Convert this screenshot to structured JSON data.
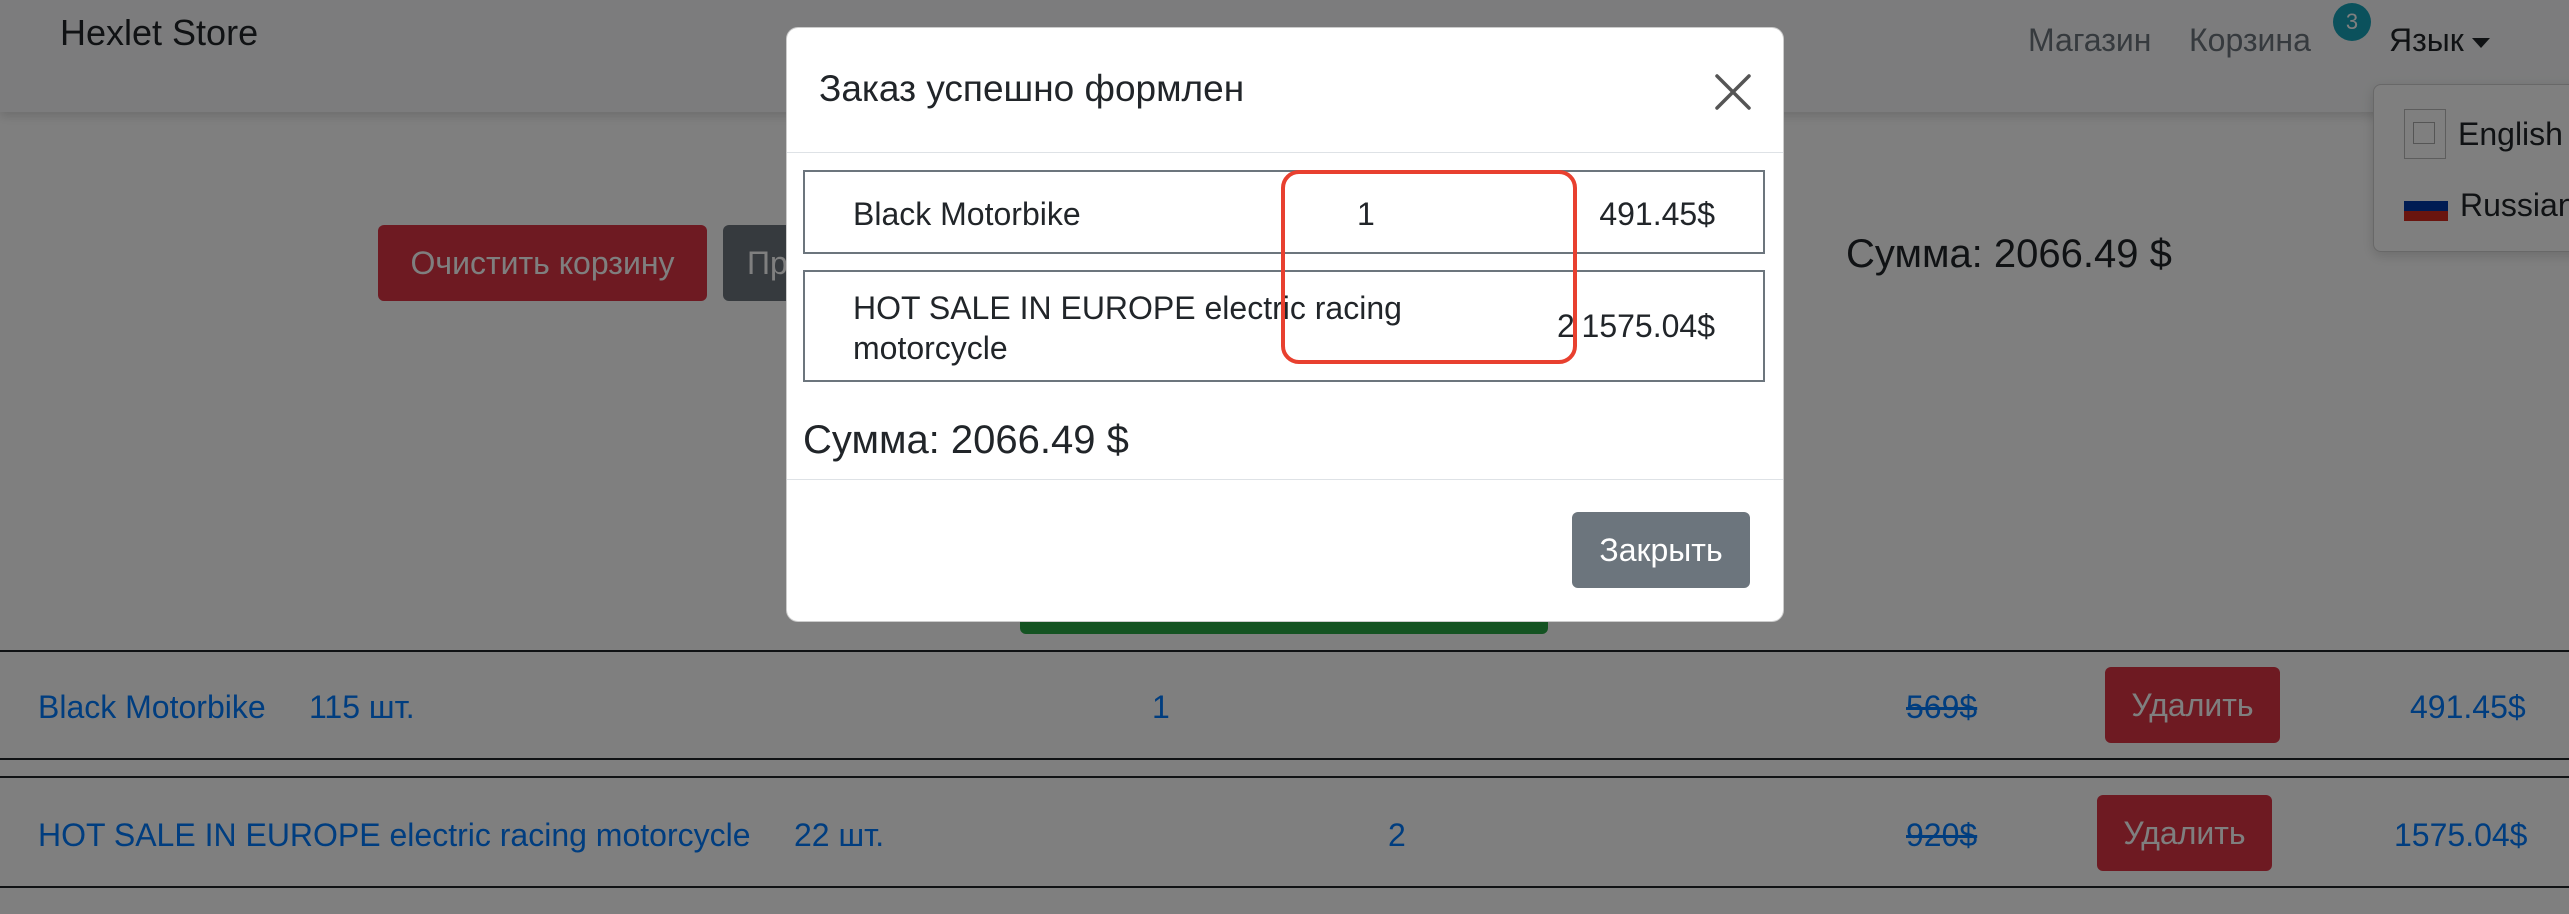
{
  "navbar": {
    "brand": "Hexlet Store",
    "links": {
      "shop": "Магазин",
      "cart": "Корзина",
      "language": "Язык"
    },
    "cart_badge": "3"
  },
  "language_menu": {
    "items": [
      {
        "label": "English",
        "icon": "broken-image-icon"
      },
      {
        "label": "Russian",
        "icon": "russia-flag-icon"
      }
    ]
  },
  "cart": {
    "clear_button": "Очистить корзину",
    "second_button_partial": "Пр",
    "sum_text": "Сумма: 2066.49 $",
    "rows": [
      {
        "name": "Black Motorbike",
        "stock": "115 шт.",
        "qty": "1",
        "old_price": "569$",
        "delete_label": "Удалить",
        "price": "491.45$"
      },
      {
        "name": "HOT SALE IN EUROPE electric racing motorcycle",
        "stock": "22 шт.",
        "qty": "2",
        "old_price": "920$",
        "delete_label": "Удалить",
        "price": "1575.04$"
      }
    ]
  },
  "modal": {
    "title": "Заказ успешно формлен",
    "items": [
      {
        "name": "Black Motorbike",
        "qty": "1",
        "price": "491.45$"
      },
      {
        "name_line1": "HOT SALE IN EUROPE electric racing",
        "name_line2": "motorcycle",
        "qty": "2",
        "price": "1575.04$"
      }
    ],
    "sum_text": "Сумма: 2066.49 $",
    "close_label": "Закрыть"
  },
  "colors": {
    "danger": "#dc3545",
    "secondary": "#6c757d",
    "success": "#28a745",
    "link": "#007bff",
    "badge": "#17a2b8",
    "annotation": "#e8402f"
  }
}
